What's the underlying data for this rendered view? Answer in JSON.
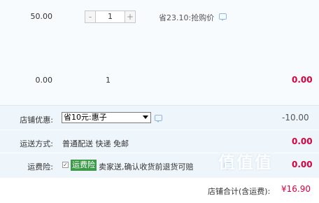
{
  "items": [
    {
      "unit_price": "50.00",
      "quantity": "1",
      "stepper_minus": "-",
      "stepper_plus": "+",
      "promo_text": "省23.10:抢购价",
      "subtotal": "0.00"
    },
    {
      "unit_price": "0.00",
      "quantity": "1",
      "subtotal": "0.00"
    }
  ],
  "shop_discount": {
    "label": "店铺优惠:",
    "selected_option": "省10元:惠子",
    "value": "-10.00"
  },
  "shipping": {
    "label": "运送方式:",
    "text": "普通配送 快递 免邮",
    "value": "0.00"
  },
  "insurance": {
    "label": "运费险:",
    "checkbox_mark": "✓",
    "tag": "运费险",
    "text": "卖家送,确认收货前退货可赔",
    "value": "0.00"
  },
  "watermark": "值值值",
  "total": {
    "label": "店铺合计(含运费):",
    "value": "¥16.90"
  },
  "colors": {
    "accent_red": "#d9003b",
    "insurance_tag": "#3c9a48",
    "chat_icon": "#8ab8e6"
  }
}
